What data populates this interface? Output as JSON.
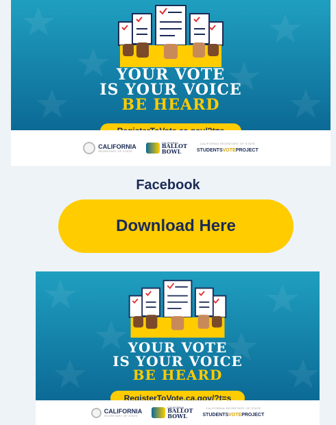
{
  "graphic_1": {
    "headline_line1": "YOUR VOTE",
    "headline_line2": "IS YOUR VOICE",
    "headline_line3": "BE HEARD",
    "url": "RegisterToVote.ca.gov/?t=s",
    "logos": {
      "california_title": "CALIFORNIA",
      "california_subtitle": "SECRETARY OF STATE",
      "ballot_bowl_small": "CALIFORNIA",
      "ballot_bowl_line1": "BALLOT",
      "ballot_bowl_line2": "BOWL",
      "svp_small": "CALIFORNIA SECRETARY OF STATE",
      "svp_part1": "STUDENTS",
      "svp_part2": "VOTE",
      "svp_part3": "PROJECT"
    }
  },
  "section": {
    "platform_label": "Facebook",
    "download_label": "Download Here"
  },
  "graphic_2": {
    "headline_line1": "YOUR VOTE",
    "headline_line2": "IS YOUR VOICE",
    "headline_line3": "BE HEARD",
    "url": "RegisterToVote.ca.gov/?t=s",
    "logos": {
      "california_title": "CALIFORNIA",
      "california_subtitle": "SECRETARY OF STATE",
      "ballot_bowl_small": "CALIFORNIA",
      "ballot_bowl_line1": "BALLOT",
      "ballot_bowl_line2": "BOWL",
      "svp_small": "CALIFORNIA SECRETARY OF STATE",
      "svp_part1": "STUDENTS",
      "svp_part2": "VOTE",
      "svp_part3": "PROJECT"
    }
  },
  "colors": {
    "background": "#eef3f8",
    "poster_blue_top": "#1f9fc0",
    "poster_blue_bottom": "#0c6a95",
    "accent_yellow": "#ffcc00",
    "navy": "#1a2a55",
    "ballot_check": "#e03030"
  }
}
